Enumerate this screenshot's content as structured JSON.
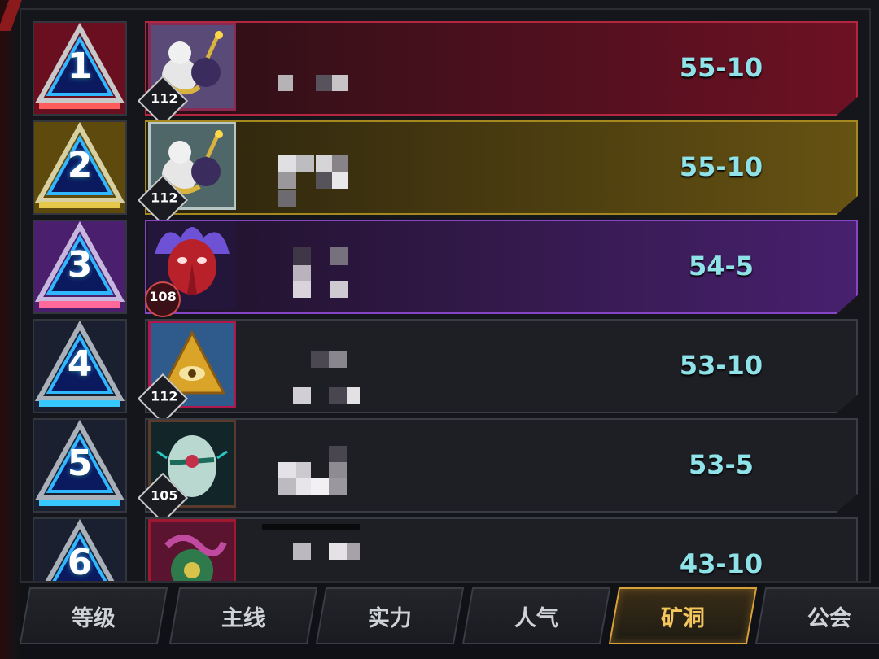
{
  "colors": {
    "rank1_bar": "#7a1026",
    "rank2_bar": "#6a5512",
    "rank3_bar": "#4b1f73",
    "default_bar": "#1f2127",
    "score_text": "#8fe3e8",
    "active_tab": "#f3c75d"
  },
  "rankings": [
    {
      "rank": "1",
      "level": "112",
      "score": "55-10",
      "avatar_icon": "snowman-bomb-icon",
      "bar_color": "#6d1124"
    },
    {
      "rank": "2",
      "level": "112",
      "score": "55-10",
      "avatar_icon": "snowman-bomb-icon",
      "bar_color": "#5e4a12"
    },
    {
      "rank": "3",
      "level": "108",
      "score": "54-5",
      "avatar_icon": "masked-demon-icon",
      "bar_color": "#43206a"
    },
    {
      "rank": "4",
      "level": "112",
      "score": "53-10",
      "avatar_icon": "eye-pyramid-icon",
      "bar_color": "#1d1f25"
    },
    {
      "rank": "5",
      "level": "105",
      "score": "53-5",
      "avatar_icon": "easter-egg-icon",
      "bar_color": "#1d1f25"
    },
    {
      "rank": "6",
      "level": "",
      "score": "43-10",
      "avatar_icon": "serpent-clock-icon",
      "bar_color": "#1d1f25"
    }
  ],
  "tabs": [
    {
      "label": "等级",
      "active": false
    },
    {
      "label": "主线",
      "active": false
    },
    {
      "label": "实力",
      "active": false
    },
    {
      "label": "人气",
      "active": false
    },
    {
      "label": "矿洞",
      "active": true
    },
    {
      "label": "公会",
      "active": false
    }
  ]
}
